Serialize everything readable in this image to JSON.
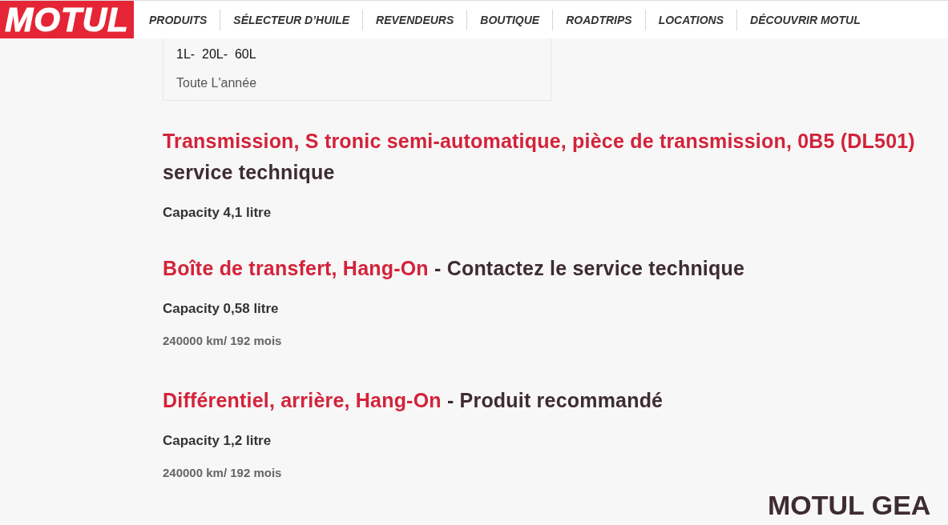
{
  "header": {
    "logo": "MOTUL",
    "nav": [
      "PRODUITS",
      "SÉLECTEUR D’HUILE",
      "REVENDEURS",
      "BOUTIQUE",
      "ROADTRIPS",
      "LOCATIONS",
      "DÉCOUVRIR MOTUL"
    ]
  },
  "package_card": {
    "sizes": "1L-  20L-  60L",
    "period": "Toute L'année"
  },
  "sections": [
    {
      "part": "Transmission, S tronic semi-automatique, pièce de transmission, 0B5 (DL501)",
      "note": "service technique",
      "capacity": "Capacity 4,1 litre"
    },
    {
      "part": "Boîte de transfert, Hang-On",
      "note": "- Contactez le service technique",
      "capacity": "Capacity 0,58 litre",
      "interval": "240000 km/ 192 mois"
    },
    {
      "part": "Différentiel, arrière, Hang-On",
      "note": "- Produit recommandé",
      "capacity": "Capacity 1,2 litre",
      "interval": "240000 km/ 192 mois"
    }
  ],
  "footer_heading": "MOTUL GEA"
}
